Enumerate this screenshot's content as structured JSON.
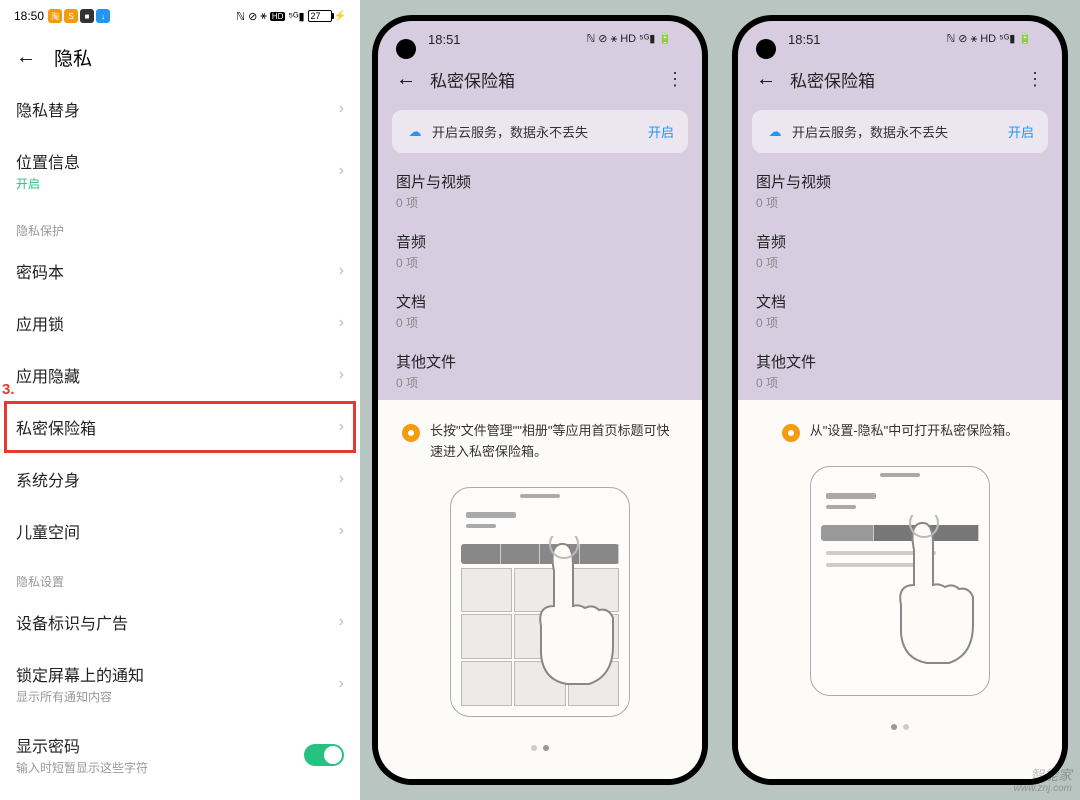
{
  "col1": {
    "time": "18:50",
    "battery": "27",
    "header_title": "隐私",
    "step_label": "3.",
    "rows": {
      "privacy_sub": "隐私替身",
      "location": "位置信息",
      "location_status": "开启",
      "section_protect": "隐私保护",
      "password_book": "密码本",
      "app_lock": "应用锁",
      "app_hide": "应用隐藏",
      "private_safe": "私密保险箱",
      "system_clone": "系统分身",
      "kids_space": "儿童空间",
      "section_settings": "隐私设置",
      "device_ad": "设备标识与广告",
      "lock_notif": "锁定屏幕上的通知",
      "lock_notif_sub": "显示所有通知内容",
      "show_pwd": "显示密码",
      "show_pwd_sub": "输入时短暂显示这些字符"
    }
  },
  "phone": {
    "time": "18:51",
    "title": "私密保险箱",
    "cloud_text": "开启云服务，数据永不丢失",
    "cloud_action": "开启",
    "items": [
      {
        "label": "图片与视频",
        "sub": "0 项"
      },
      {
        "label": "音频",
        "sub": "0 项"
      },
      {
        "label": "文档",
        "sub": "0 项"
      },
      {
        "label": "其他文件",
        "sub": "0 项"
      }
    ],
    "tip_a": "长按\"文件管理\"\"相册\"等应用首页标题可快速进入私密保险箱。",
    "tip_b": "从\"设置-隐私\"中可打开私密保险箱。"
  },
  "watermark": {
    "main": "智能家",
    "sub": "www.znj.com"
  }
}
